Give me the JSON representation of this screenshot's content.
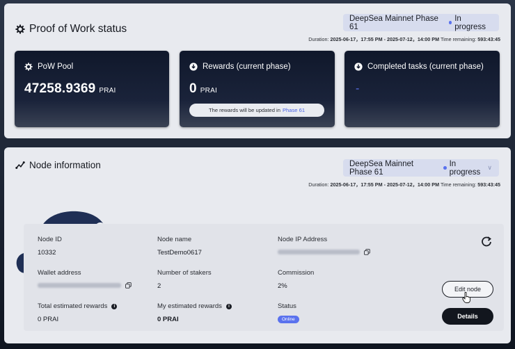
{
  "pow": {
    "title": "Proof of Work status",
    "phase": {
      "name": "DeepSea Mainnet Phase 61",
      "status": "In progress"
    },
    "duration": {
      "label": "Duration:",
      "range": "2025-06-17，17:55 PM - 2025-07-12，14:00 PM",
      "remaining_label": "Time remaining:",
      "remaining": "593:43:45"
    },
    "cards": {
      "pool": {
        "title": "PoW Pool",
        "value": "47258.9369",
        "unit": "PRAI"
      },
      "rewards": {
        "title": "Rewards (current phase)",
        "value": "0",
        "unit": "PRAI",
        "note": "The rewards will be updated in",
        "note_link": "Phase 61"
      },
      "tasks": {
        "title": "Completed tasks (current phase)",
        "value": "-"
      }
    }
  },
  "node": {
    "title": "Node information",
    "phase": {
      "name": "DeepSea Mainnet Phase 61",
      "status": "In progress"
    },
    "duration": {
      "label": "Duration:",
      "range": "2025-06-17，17:55 PM - 2025-07-12，14:00 PM",
      "remaining_label": "Time remaining:",
      "remaining": "593:43:45"
    },
    "fields": {
      "node_id": {
        "label": "Node ID",
        "value": "10332"
      },
      "node_name": {
        "label": "Node name",
        "value": "TestDemo0617"
      },
      "ip": {
        "label": "Node IP Address"
      },
      "wallet": {
        "label": "Wallet address"
      },
      "stakers": {
        "label": "Number of stakers",
        "value": "2"
      },
      "commission": {
        "label": "Commission",
        "value": "2%"
      },
      "total_rewards": {
        "label": "Total estimated rewards",
        "value": "0 PRAI"
      },
      "my_rewards": {
        "label": "My estimated rewards",
        "value": "0 PRAI"
      },
      "status": {
        "label": "Status",
        "value": "Online"
      }
    },
    "buttons": {
      "edit": "Edit node",
      "details": "Details"
    }
  },
  "colors": {
    "accent": "#5a72ee",
    "card_dark": "#10182b",
    "panel": "#e8eaef"
  }
}
